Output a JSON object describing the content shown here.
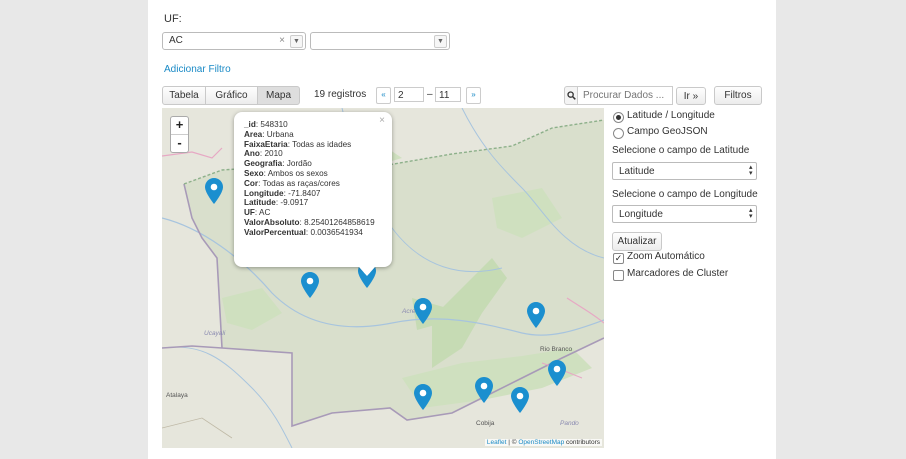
{
  "filter": {
    "uf_label": "UF:",
    "uf_value": "AC",
    "clear_symbol": "×",
    "second_value": "",
    "add_filter": "Adicionar Filtro"
  },
  "toolbar": {
    "tabs": [
      "Tabela",
      "Gráfico",
      "Mapa"
    ],
    "active_tab": "Mapa",
    "records": "19 registros",
    "pager_prev": "«",
    "pager_from": "2",
    "pager_dash": "–",
    "pager_to": "11",
    "pager_next": "»",
    "search_placeholder": "Procurar Dados ...",
    "go_button": "Ir »",
    "filters_button": "Filtros"
  },
  "map": {
    "zoom_in": "+",
    "zoom_out": "-",
    "popup_close": "×",
    "popup": [
      {
        "key": "_id",
        "value": "548310"
      },
      {
        "key": "Area",
        "value": "Urbana"
      },
      {
        "key": "FaixaEtaria",
        "value": "Todas as idades"
      },
      {
        "key": "Ano",
        "value": "2010"
      },
      {
        "key": "Geografia",
        "value": "Jordão"
      },
      {
        "key": "Sexo",
        "value": "Ambos os sexos"
      },
      {
        "key": "Cor",
        "value": "Todas as raças/cores"
      },
      {
        "key": "Longitude",
        "value": "-71.8407"
      },
      {
        "key": "Latitude",
        "value": "-9.0917"
      },
      {
        "key": "UF",
        "value": "AC"
      },
      {
        "key": "ValorAbsoluto",
        "value": "8.25401264858619"
      },
      {
        "key": "ValorPercentual",
        "value": "0.0036541934"
      }
    ],
    "labels": {
      "acre": "Acre",
      "ucayali": "Ucayali",
      "rio_branco": "Rio Branco",
      "atalaya": "Atalaya",
      "cobija": "Cobija",
      "pando": "Pando"
    },
    "attribution_link1": "Leaflet",
    "attribution_mid": " | © ",
    "attribution_link2": "OpenStreetMap",
    "attribution_end": " contributors",
    "marker_color": "#1b8fcf"
  },
  "panel": {
    "radio_latlon": "Latitude / Longitude",
    "radio_geojson": "Campo GeoJSON",
    "lat_label": "Selecione o campo de Latitude",
    "lat_value": "Latitude",
    "lon_label": "Selecione o campo de Longitude",
    "lon_value": "Longitude",
    "update_button": "Atualizar",
    "auto_zoom": "Zoom Automático",
    "cluster": "Marcadores de Cluster"
  }
}
